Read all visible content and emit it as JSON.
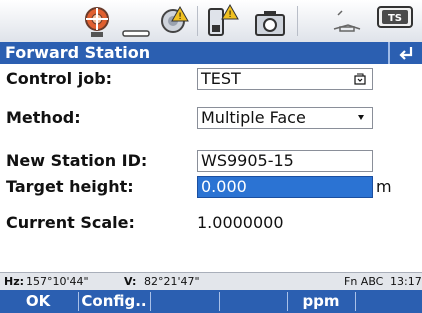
{
  "screen": {
    "title": "Forward Station",
    "statusbar_icons": [
      "satellite-icon",
      "radio-link-icon",
      "battery-warning-icon",
      "camera-icon",
      "level-icon",
      "keyboard-icon"
    ],
    "statusbar_keyboard_label": "TS",
    "fields": {
      "control_job": {
        "label": "Control job:",
        "value": "TEST"
      },
      "method": {
        "label": "Method:",
        "value": "Multiple Face"
      },
      "new_station_id": {
        "label": "New Station ID:",
        "value": "WS9905-15"
      },
      "target_height": {
        "label": "Target height:",
        "value": "0.000",
        "unit": "m"
      },
      "current_scale": {
        "label": "Current Scale:",
        "value": "1.0000000"
      }
    },
    "infobar": {
      "hz_label": "Hz:",
      "hz_value": "157°10'44\"",
      "v_label": "V:",
      "v_value": "82°21'47\"",
      "mode": "Fn ABC",
      "time": "13:17"
    },
    "softkeys": [
      "OK",
      "Config..",
      "",
      "",
      "ppm",
      ""
    ]
  }
}
